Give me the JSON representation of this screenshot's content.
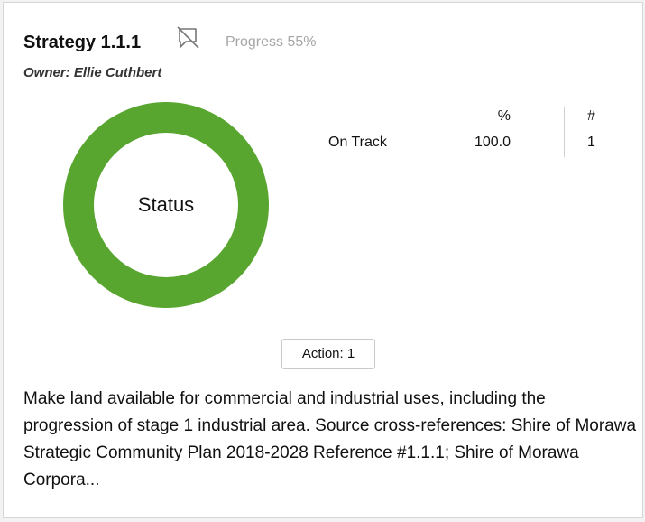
{
  "card": {
    "title": "Strategy 1.1.1",
    "comment_icon": "comment-off-icon",
    "progress": "Progress 55%",
    "owner": "Owner: Ellie Cuthbert"
  },
  "status_chart": {
    "center_label": "Status",
    "ring_color": "#58a630",
    "slices": [
      {
        "name": "On Track",
        "percent": 100.0
      }
    ]
  },
  "stats_table": {
    "headers": {
      "percent": "%",
      "count": "#"
    },
    "rows": [
      {
        "label": "On Track",
        "percent": "100.0",
        "count": "1"
      }
    ]
  },
  "action_button": {
    "label": "Action: 1"
  },
  "description": "Make land available for commercial and industrial uses, including the progression of stage 1 industrial area. Source cross-references: Shire of Morawa Strategic Community Plan 2018-2028 Reference #1.1.1; Shire of Morawa Corpora..."
}
